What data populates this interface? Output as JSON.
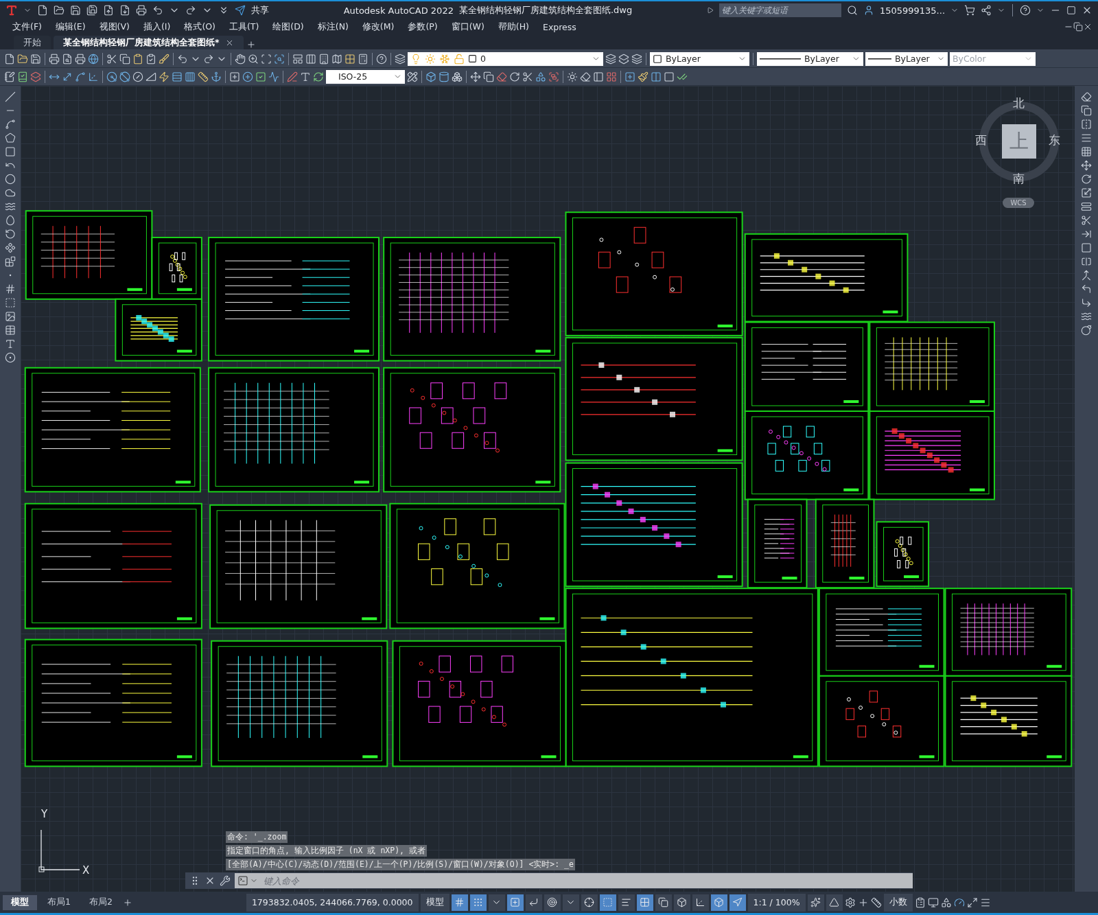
{
  "title_bar": {
    "app_title": "Autodesk AutoCAD 2022",
    "file_name": "某全钢结构轻钢厂房建筑结构全套图纸.dwg",
    "share": "共享",
    "search": {
      "placeholder": "键入关键字或短语"
    },
    "user": "1505999135..."
  },
  "menu": [
    "文件(F)",
    "编辑(E)",
    "视图(V)",
    "插入(I)",
    "格式(O)",
    "工具(T)",
    "绘图(D)",
    "标注(N)",
    "修改(M)",
    "参数(P)",
    "窗口(W)",
    "帮助(H)",
    "Express"
  ],
  "doc_tabs": [
    {
      "label": "开始",
      "selected": false
    },
    {
      "label": "某全钢结构轻钢厂房建筑结构全套图纸*",
      "selected": true
    }
  ],
  "properties": {
    "layer": "0",
    "color_setting": "ByLayer",
    "linetype": "ByLayer",
    "lineweight": "ByLayer",
    "plot_style": {
      "value": "ByColor",
      "disabled": true
    }
  },
  "dim_style": "ISO-25",
  "viewcube": {
    "north": "北",
    "south": "南",
    "east": "东",
    "west": "西",
    "top": "上",
    "wcs": "WCS"
  },
  "ucs": {
    "x": "X",
    "y": "Y"
  },
  "command_history": [
    "命令: '_.zoom",
    "指定窗口的角点, 输入比例因子 (nX 或 nXP), 或者",
    "[全部(A)/中心(C)/动态(D)/范围(E)/上一个(P)/比例(S)/窗口(W)/对象(O)] <实时>: _e"
  ],
  "command_input": {
    "placeholder": "键入命令"
  },
  "layout_tabs": [
    {
      "label": "模型",
      "selected": true
    },
    {
      "label": "布局1",
      "selected": false
    },
    {
      "label": "布局2",
      "selected": false
    }
  ],
  "status_bar": {
    "coordinates": "1793832.0405, 244066.7769, 0.0000",
    "space": "模型",
    "scale": "1:1 / 100%",
    "units": "小数"
  },
  "status_toggles": [
    {
      "on": true
    },
    {
      "on": true
    },
    {
      "on": false
    },
    {
      "on": true
    },
    {
      "on": false
    },
    {
      "on": false
    },
    {
      "on": false
    },
    {
      "on": false
    },
    {
      "on": true
    },
    {
      "on": false
    },
    {
      "on": true
    },
    {
      "on": false
    },
    {
      "on": false
    },
    {
      "on": false
    },
    {
      "on": true
    },
    {
      "on": true
    },
    {
      "on": false
    },
    {
      "on": false
    }
  ]
}
